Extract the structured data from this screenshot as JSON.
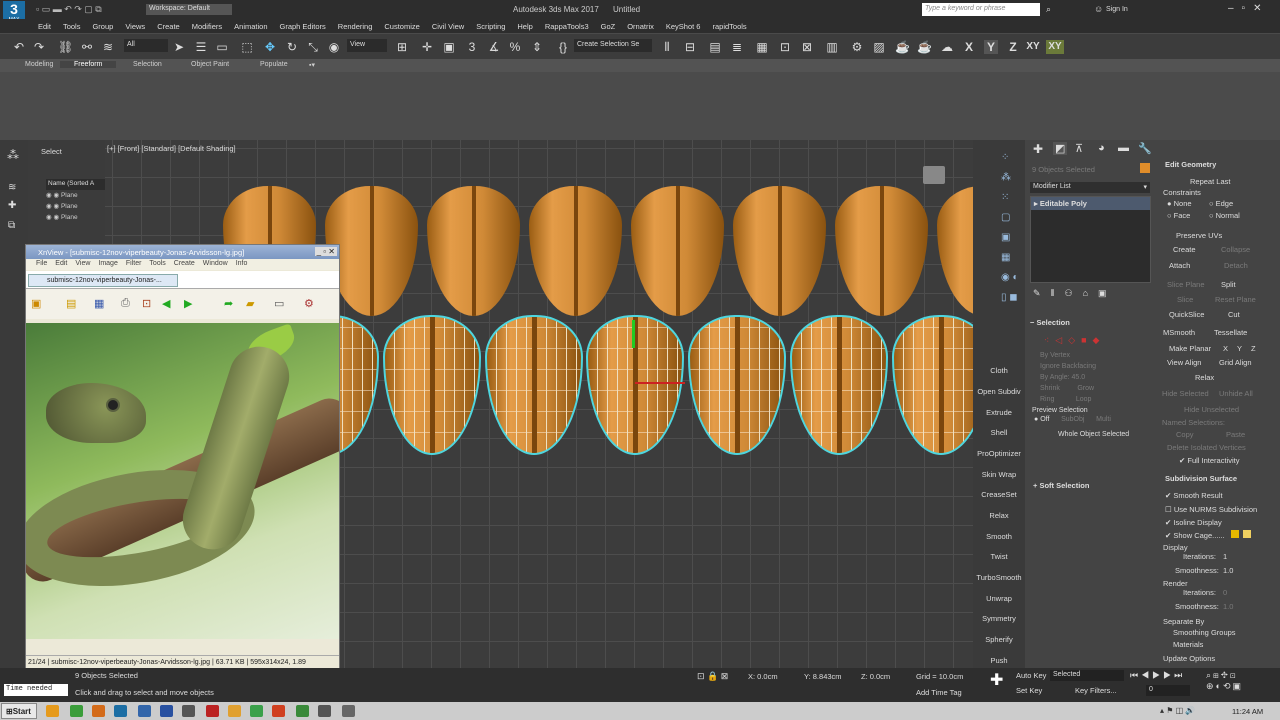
{
  "app": {
    "title": "Autodesk 3ds Max 2017",
    "file": "Untitled",
    "workspace": "Workspace: Default",
    "search_placeholder": "Type a keyword or phrase",
    "sign_in": "Sign In",
    "logo": "3",
    "logo_sub": "MAX"
  },
  "menu": [
    "Edit",
    "Tools",
    "Group",
    "Views",
    "Create",
    "Modifiers",
    "Animation",
    "Graph Editors",
    "Rendering",
    "Customize",
    "Civil View",
    "Scripting",
    "Help",
    "RappaTools3",
    "GoZ",
    "Ornatrix",
    "KeyShot 6",
    "rapidTools"
  ],
  "toolbar": {
    "filter": "All",
    "view": "View",
    "selection_set": "Create Selection Se",
    "axes": [
      "X",
      "Y",
      "Z",
      "XY",
      "XY"
    ]
  },
  "ribbon_tabs": [
    "Modeling",
    "Freeform",
    "Selection",
    "Object Paint",
    "Populate"
  ],
  "scene_explorer": {
    "mode": "Select",
    "column": "Name (Sorted A",
    "items": [
      "Plane",
      "Plane",
      "Plane"
    ]
  },
  "viewport": {
    "label": "[+] [Front] [Standard] [Default Shading]"
  },
  "viewport_buttons": [
    "Cloth",
    "Open Subdiv",
    "Extrude",
    "Shell",
    "ProOptimizer",
    "Skin Wrap",
    "CreaseSet",
    "Relax",
    "Smooth",
    "Twist",
    "TurboSmooth",
    "Unwrap",
    "Symmetry",
    "Spherify",
    "Push"
  ],
  "command_panel": {
    "objects_selected": "9 Objects Selected",
    "modifier_list": "Modifier List",
    "stack_item": "Editable Poly",
    "selection_header": "Selection",
    "by_vertex": "By Vertex",
    "ignore_backfacing": "Ignore Backfacing",
    "by_angle": "By Angle:",
    "by_angle_val": "45.0",
    "shrink": "Shrink",
    "grow": "Grow",
    "ring": "Ring",
    "loop": "Loop",
    "preview_selection": "Preview Selection",
    "off": "Off",
    "subobj": "SubObj",
    "multi": "Multi",
    "whole_object": "Whole Object Selected",
    "soft_selection": "Soft Selection",
    "accent": "#e08d2a"
  },
  "edit_geometry": {
    "header": "Edit Geometry",
    "repeat_last": "Repeat Last",
    "constraints": "Constraints",
    "none": "None",
    "edge": "Edge",
    "face": "Face",
    "normal": "Normal",
    "preserve_uvs": "Preserve UVs",
    "create": "Create",
    "collapse": "Collapse",
    "attach": "Attach",
    "detach": "Detach",
    "slice_plane": "Slice Plane",
    "split": "Split",
    "slice": "Slice",
    "reset_plane": "Reset Plane",
    "quickslice": "QuickSlice",
    "cut": "Cut",
    "msmooth": "MSmooth",
    "tessellate": "Tessellate",
    "make_planar": "Make Planar",
    "x": "X",
    "y": "Y",
    "z": "Z",
    "view_align": "View Align",
    "grid_align": "Grid Align",
    "relax": "Relax",
    "hide_selected": "Hide Selected",
    "unhide_all": "Unhide All",
    "hide_unselected": "Hide Unselected",
    "named_selections": "Named Selections:",
    "copy": "Copy",
    "paste": "Paste",
    "delete_isolated": "Delete Isolated Vertices",
    "full_interactivity": "Full Interactivity"
  },
  "subdivision": {
    "header": "Subdivision Surface",
    "smooth_result": "Smooth Result",
    "use_nurms": "Use NURMS Subdivision",
    "isoline": "Isoline Display",
    "show_cage": "Show Cage......",
    "display": "Display",
    "iterations": "Iterations:",
    "iter_val": "1",
    "smoothness": "Smoothness:",
    "smooth_val": "1.0",
    "render": "Render",
    "r_iter": "0",
    "r_smooth": "1.0",
    "separate_by": "Separate By",
    "smoothing_groups": "Smoothing Groups",
    "materials": "Materials",
    "update_options": "Update Options"
  },
  "xnview": {
    "title": "XnView - [submisc-12nov-viperbeauty-Jonas-Arvidsson-lg.jpg]",
    "menu": [
      "File",
      "Edit",
      "View",
      "Image",
      "Filter",
      "Tools",
      "Create",
      "Window",
      "Info"
    ],
    "tab": "submisc-12nov-viperbeauty-Jonas-...",
    "status_idx": "21/24",
    "status_file": "submisc-12nov-viperbeauty-Jonas-Arvidsson-lg.jpg",
    "status_size": "63.71 KB",
    "status_dims": "595x314x24, 1.89"
  },
  "status": {
    "max_listener": "Time needed",
    "objects": "9 Objects Selected",
    "prompt": "Click and drag to select and move objects",
    "x": "0.0cm",
    "y": "8.843cm",
    "z": "0.0cm",
    "grid": "Grid = 10.0cm",
    "add_time_tag": "Add Time Tag",
    "auto_key": "Auto Key",
    "selected": "Selected",
    "set_key": "Set Key",
    "key_filters": "Key Filters...",
    "frame": "0"
  },
  "taskbar": {
    "start": "Start",
    "time": "11:24 AM"
  }
}
